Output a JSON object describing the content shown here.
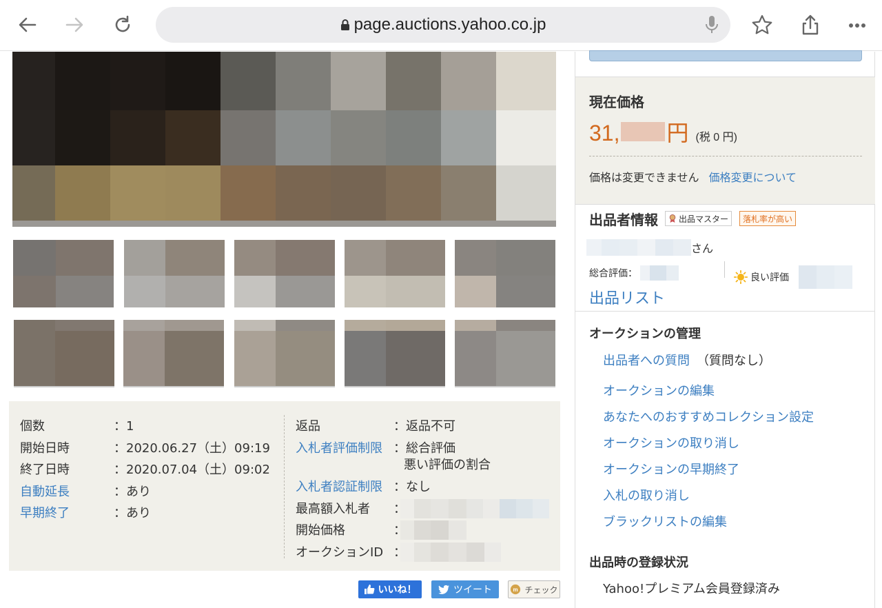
{
  "browser": {
    "url": "page.auctions.yahoo.co.jp"
  },
  "info": {
    "left": [
      {
        "label": "個数",
        "value": "：1",
        "link": false
      },
      {
        "label": "開始日時",
        "value": "：2020.06.27（土）09:19",
        "link": false
      },
      {
        "label": "終了日時",
        "value": "：2020.07.04（土）09:02",
        "link": false
      },
      {
        "label": "自動延長",
        "value": "：あり",
        "link": true
      },
      {
        "label": "早期終了",
        "value": "：あり",
        "link": true
      }
    ],
    "right": {
      "return_label": "返品",
      "return_value": "：返品不可",
      "eval_limit_label": "入札者評価制限",
      "eval_limit_value_1": "：総合評価",
      "eval_limit_value_2": "悪い評価の割合",
      "auth_limit_label": "入札者認証制限",
      "auth_limit_value": "：なし",
      "top_bidder_label": "最高額入札者",
      "start_price_label": "開始価格",
      "auction_id_label": "オークションID",
      "colon": "："
    }
  },
  "social": {
    "like": "いいね！",
    "tweet": "ツイート",
    "check": "チェック"
  },
  "sidebar": {
    "price_title": "現在価格",
    "price_prefix": "31,",
    "price_unit": "円",
    "price_tax": "(税 0 円)",
    "price_note": "価格は変更できません",
    "price_link": "価格変更について",
    "seller_title": "出品者情報",
    "badge_master": "出品マスター",
    "badge_rate": "落札率が高い",
    "seller_suffix": "さん",
    "total_eval_label": "総合評価：",
    "good_eval_label": "良い評価",
    "seller_list": "出品リスト",
    "manage_title": "オークションの管理",
    "question_link": "出品者への質問",
    "question_note": "（質問なし）",
    "manage_links": [
      "オークションの編集",
      "あなたへのおすすめコレクション設定",
      "オークションの取り消し",
      "オークションの早期終了",
      "入札の取り消し",
      "ブラックリストの編集"
    ],
    "registration_title": "出品時の登録状況",
    "registration_value": "Yahoo!プレミアム会員登録済み"
  },
  "colors": {
    "link": "#3d7fc1",
    "price": "#d2691e",
    "panel_bg": "#f1f0ea"
  },
  "icons": [
    "back-arrow-icon",
    "forward-arrow-icon",
    "reload-icon",
    "lock-icon",
    "mic-icon",
    "star-icon",
    "share-icon",
    "more-icon",
    "seller-master-icon",
    "sun-icon",
    "facebook-like-icon",
    "twitter-icon",
    "check-logo-icon"
  ]
}
